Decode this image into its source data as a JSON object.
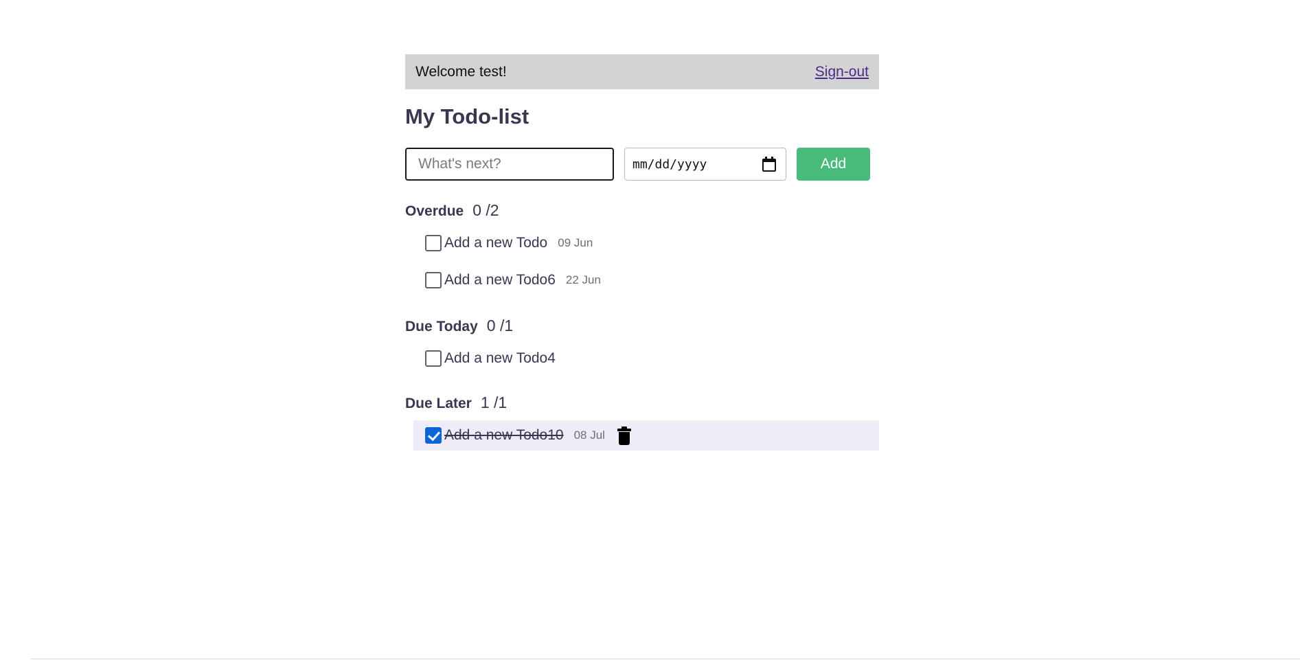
{
  "header": {
    "welcome_text": "Welcome test!",
    "signout_label": "Sign-out"
  },
  "page_title": "My Todo-list",
  "add_form": {
    "text_placeholder": "What's next?",
    "text_value": "",
    "date_placeholder": "mm/dd/yyyy",
    "add_label": "Add",
    "add_color": "#48bb78"
  },
  "sections": [
    {
      "name": "Overdue",
      "count": "0 /2",
      "todos": [
        {
          "text": "Add a new Todo",
          "date": "09 Jun",
          "completed": false
        },
        {
          "text": "Add a new Todo6",
          "date": "22 Jun",
          "completed": false
        }
      ]
    },
    {
      "name": "Due Today",
      "count": "0 /1",
      "todos": [
        {
          "text": "Add a new Todo4",
          "date": "",
          "completed": false
        }
      ]
    },
    {
      "name": "Due Later",
      "count": "1 /1",
      "todos": [
        {
          "text": "Add a new Todo10",
          "date": "08 Jul",
          "completed": true,
          "icon": "trash-icon"
        }
      ]
    }
  ]
}
